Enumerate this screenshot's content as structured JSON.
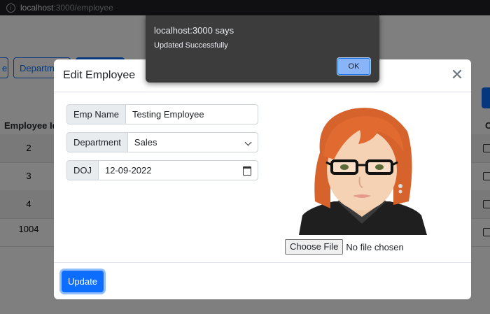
{
  "browser": {
    "url_host": "localhost",
    "url_path": ":3000/employee"
  },
  "background": {
    "tab_fragment_1": "e",
    "tab_fragment_2": "Departme",
    "table": {
      "header_id": "Employee Id",
      "header_right": "O",
      "rows": [
        "2",
        "3",
        "4",
        "1004"
      ]
    }
  },
  "modal": {
    "title": "Edit Employee",
    "close_icon": "close-icon",
    "fields": {
      "name_label": "Emp Name",
      "name_value": "Testing Employee",
      "department_label": "Department",
      "department_value": "Sales",
      "doj_label": "DOJ",
      "doj_value": "12-09-2022"
    },
    "file_input": {
      "button_label": "Choose File",
      "status": "No file chosen"
    },
    "update_label": "Update"
  },
  "alert": {
    "title": "localhost:3000 says",
    "message": "Updated Successfully",
    "ok_label": "OK"
  },
  "colors": {
    "primary": "#0d6efd",
    "alert_bg": "#3c3c3c",
    "ok_bg": "#8ab4f8"
  }
}
